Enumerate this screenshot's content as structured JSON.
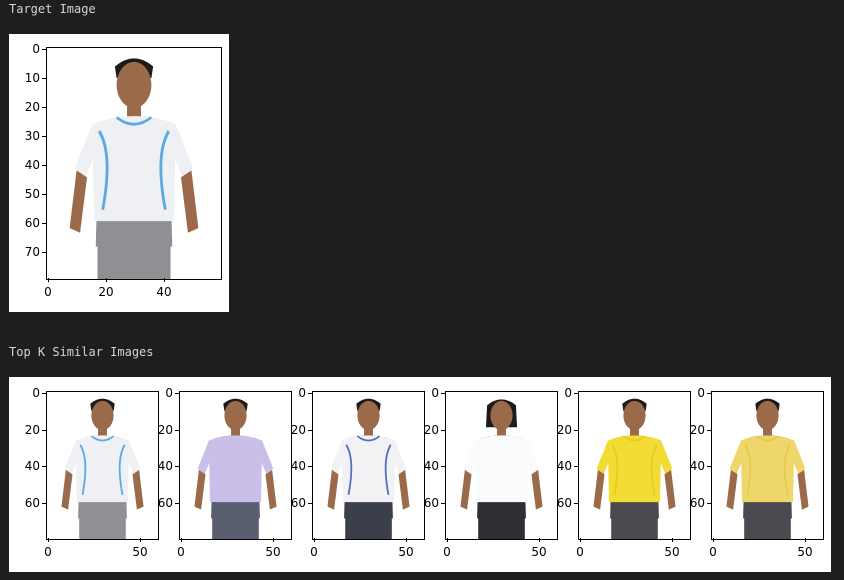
{
  "labels": {
    "target": "Target Image",
    "similar": "Top K Similar Images"
  },
  "target_plot": {
    "yticks": [
      "0",
      "10",
      "20",
      "30",
      "40",
      "50",
      "60",
      "70"
    ],
    "xticks": [
      "0",
      "20",
      "40"
    ],
    "shirt_color": "#eef0f4",
    "trim_color": "#5aa9e0",
    "pants_color": "#8e9094"
  },
  "similar_plots": {
    "yticks": [
      "0",
      "20",
      "40",
      "60"
    ],
    "xticks": [
      "0",
      "50"
    ],
    "items": [
      {
        "shirt_color": "#eef0f4",
        "trim_color": "#5aa9e0",
        "pants_color": "#8e9094",
        "person": "man"
      },
      {
        "shirt_color": "#c9bfe8",
        "trim_color": "#c9bfe8",
        "pants_color": "#5a5f70",
        "person": "man"
      },
      {
        "shirt_color": "#f2f2f4",
        "trim_color": "#4f6fc0",
        "pants_color": "#3a3f4a",
        "person": "man"
      },
      {
        "shirt_color": "#fafbfd",
        "trim_color": "#fafbfd",
        "pants_color": "#2e2e34",
        "person": "woman"
      },
      {
        "shirt_color": "#f2dc34",
        "trim_color": "#e6cc20",
        "pants_color": "#4a4a50",
        "person": "man"
      },
      {
        "shirt_color": "#eed66a",
        "trim_color": "#e2c856",
        "pants_color": "#4a4a50",
        "person": "man"
      }
    ]
  }
}
